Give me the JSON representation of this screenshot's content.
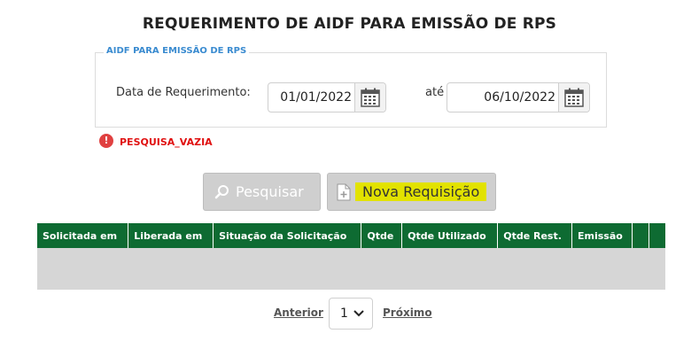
{
  "page_title": "REQUERIMENTO DE AIDF PARA EMISSÃO DE RPS",
  "filter": {
    "legend": "AIDF PARA EMISSÃO DE RPS",
    "date_label": "Data de Requerimento:",
    "from_value": "01/01/2022",
    "until_label": "até",
    "to_value": "06/10/2022"
  },
  "error": {
    "icon": "!",
    "message": "PESQUISA_VAZIA"
  },
  "buttons": {
    "search": "Pesquisar",
    "new_request": "Nova Requisição"
  },
  "table": {
    "columns": [
      "Solicitada em",
      "Liberada em",
      "Situação da Solicitação",
      "Qtde",
      "Qtde Utilizado",
      "Qtde Rest.",
      "Emissão",
      "",
      ""
    ],
    "rows": []
  },
  "pagination": {
    "prev": "Anterior",
    "page": "1",
    "next": "Próximo"
  },
  "colors": {
    "header_bg": "#0e6b32",
    "error": "#e01010",
    "legend": "#3a8bd0",
    "highlight": "#e2e200"
  }
}
